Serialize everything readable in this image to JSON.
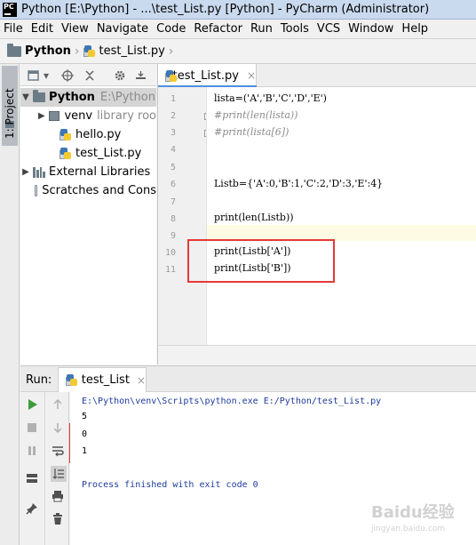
{
  "window": {
    "title": "Python [E:\\Python] - ...\\test_List.py [Python] - PyCharm (Administrator)",
    "logo": "PC"
  },
  "menu": [
    "File",
    "Edit",
    "View",
    "Navigate",
    "Code",
    "Refactor",
    "Run",
    "Tools",
    "VCS",
    "Window",
    "Help"
  ],
  "breadcrumb": {
    "project": "Python",
    "file": "test_List.py"
  },
  "left_strip": {
    "project_tab": "1: Project"
  },
  "project_tree": {
    "root_name": "Python",
    "root_path": "E:\\Python",
    "items": [
      {
        "label": "venv",
        "hint": "library roo"
      },
      {
        "label": "hello.py"
      },
      {
        "label": "test_List.py"
      },
      {
        "label": "External Libraries"
      },
      {
        "label": "Scratches and Cons"
      }
    ]
  },
  "editor": {
    "tab_label": "test_List.py",
    "line_numbers": [
      "1",
      "2",
      "3",
      "4",
      "5",
      "6",
      "7",
      "8",
      "9",
      "10",
      "11"
    ],
    "lines": [
      "lista=('A','B','C','D','E')",
      "#print(len(lista))",
      "#print(lista[6])",
      "",
      "",
      "Listb={'A':0,'B':1,'C':2,'D':3,'E':4}",
      "",
      "print(len(Listb))",
      "",
      "print(Listb['A'])",
      "print(Listb['B'])"
    ]
  },
  "run_panel": {
    "label": "Run:",
    "tab_label": "test_List",
    "console": [
      "E:\\Python\\venv\\Scripts\\python.exe E:/Python/test_List.py",
      "5",
      "0",
      "1",
      "",
      "Process finished with exit code 0"
    ]
  },
  "watermark": {
    "text": "Baidu经验",
    "sub": "jingyan.baidu.com"
  },
  "colors": {
    "highlight": "#e53935",
    "run_green": "#3d9b3d",
    "console_blue": "#1f3b9e"
  }
}
